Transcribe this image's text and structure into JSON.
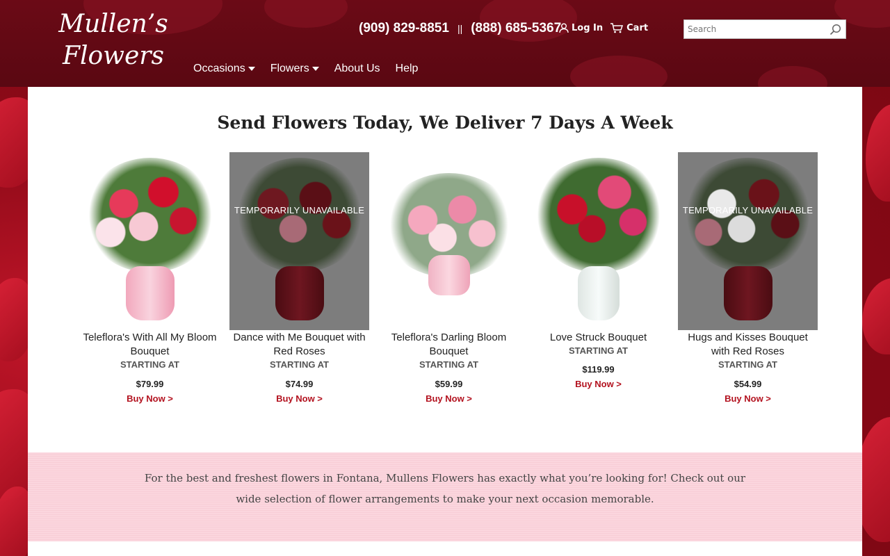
{
  "brand": {
    "logo_line1": "Mullen’s",
    "logo_line2": "Flowers"
  },
  "header": {
    "phone1": "(909) 829-8851",
    "separator": "||",
    "phone2": "(888) 685-5367",
    "login_label": "Log In",
    "cart_label": "Cart"
  },
  "search": {
    "placeholder": "Search"
  },
  "nav": {
    "occasions": "Occasions",
    "flowers": "Flowers",
    "about": "About Us",
    "help": "Help"
  },
  "main": {
    "heading": "Send Flowers Today, We Deliver 7 Days A Week"
  },
  "products": [
    {
      "name": "Teleflora's With All My Bloom Bouquet",
      "starting": "STARTING AT",
      "price": "$79.99",
      "buy": "Buy Now >",
      "unavailable": ""
    },
    {
      "name": "Dance with Me Bouquet with Red Roses",
      "starting": "STARTING AT",
      "price": "$74.99",
      "buy": "Buy Now >",
      "unavailable": "TEMPORARILY UNAVAILABLE"
    },
    {
      "name": "Teleflora's Darling Bloom Bouquet",
      "starting": "STARTING AT",
      "price": "$59.99",
      "buy": "Buy Now >",
      "unavailable": ""
    },
    {
      "name": "Love Struck Bouquet",
      "starting": "STARTING AT",
      "price": "$119.99",
      "buy": "Buy Now >",
      "unavailable": ""
    },
    {
      "name": "Hugs and Kisses Bouquet with Red Roses",
      "starting": "STARTING AT",
      "price": "$54.99",
      "buy": "Buy Now >",
      "unavailable": "TEMPORARILY UNAVAILABLE"
    }
  ],
  "promo": {
    "text": "For the best and freshest flowers in Fontana, Mullens Flowers has exactly what you’re looking for! Check out our wide selection of flower arrangements to make your next occasion memorable."
  },
  "colors": {
    "header_bg": "#5a0812",
    "accent": "#b3121f",
    "promo_bg": "#fbd6de"
  }
}
